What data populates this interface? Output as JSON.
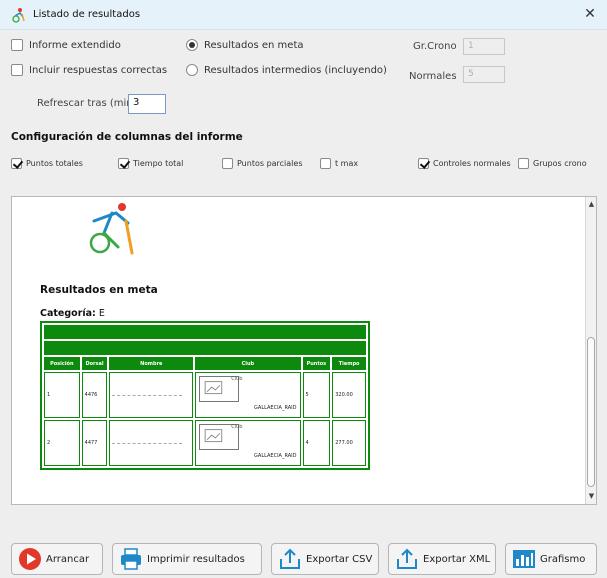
{
  "window": {
    "title": "Listado de resultados"
  },
  "options": {
    "informe_extendido": "Informe extendido",
    "incluir_respuestas": "Incluir respuestas correctas",
    "resultados_meta": "Resultados en meta",
    "resultados_intermedios": "Resultados intermedios (incluyendo)",
    "refrescar_label": "Refrescar tras (min.)",
    "refrescar_value": "3",
    "gr_crono_label": "Gr.Crono",
    "gr_crono_value": "1",
    "normales_label": "Normales",
    "normales_value": "5"
  },
  "columns": {
    "title": "Configuración de columnas del informe",
    "items": [
      {
        "label": "Puntos totales",
        "checked": true
      },
      {
        "label": "Tiempo total",
        "checked": true
      },
      {
        "label": "Puntos parciales",
        "checked": false
      },
      {
        "label": "t max",
        "checked": false
      },
      {
        "label": "Controles normales",
        "checked": true
      },
      {
        "label": "Grupos crono",
        "checked": false
      }
    ]
  },
  "report": {
    "heading": "Resultados en meta",
    "category_label": "Categoría:",
    "category_value": "E",
    "headers": [
      "Posición",
      "Dorsal",
      "Nombre",
      "Club",
      "Puntos",
      "Tiempo"
    ],
    "club_alt": "Club",
    "rows": [
      {
        "pos": "1",
        "dorsal": "4476",
        "club": "GALLAECIA_RAID",
        "puntos": "5",
        "tiempo": "320.00"
      },
      {
        "pos": "2",
        "dorsal": "4477",
        "club": "GALLAECIA_RAID",
        "puntos": "4",
        "tiempo": "277.00"
      }
    ]
  },
  "buttons": {
    "arrancar": "Arrancar",
    "imprimir": "Imprimir resultados",
    "exportar_csv": "Exportar CSV",
    "exportar_xml": "Exportar XML",
    "grafismo": "Grafismo"
  },
  "colors": {
    "report_green": "#0d8a0d",
    "accent_blue": "#1e88c8",
    "start_red": "#e0392b"
  }
}
